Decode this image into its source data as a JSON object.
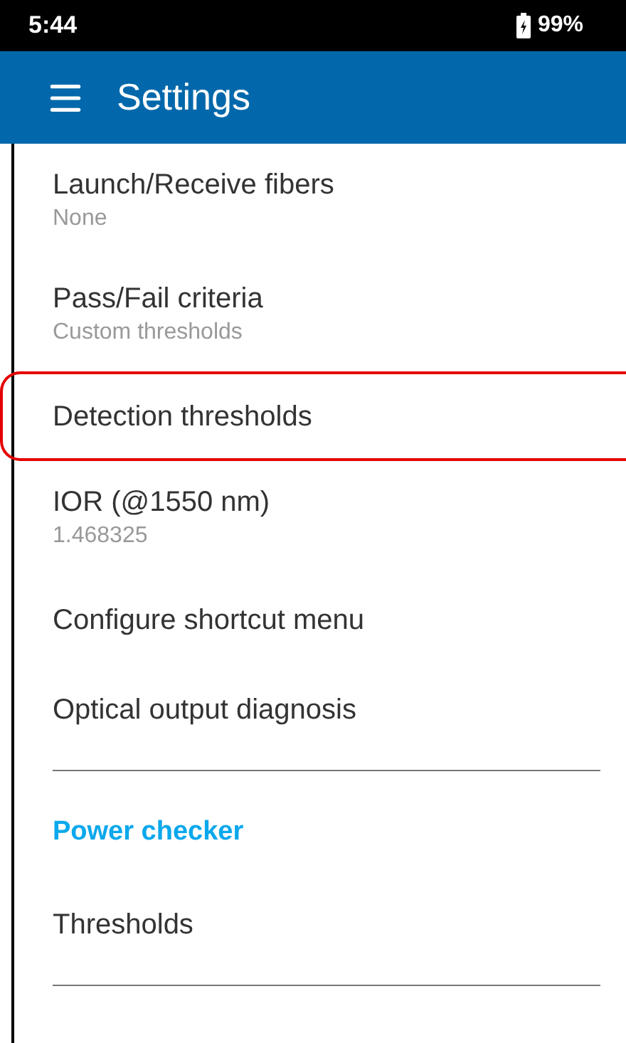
{
  "status_bar": {
    "time": "5:44",
    "battery": "99%"
  },
  "app_bar": {
    "title": "Settings"
  },
  "items": [
    {
      "kind": "item",
      "title": "Launch/Receive fibers",
      "subtitle": "None",
      "selected": false
    },
    {
      "kind": "item",
      "title": "Pass/Fail criteria",
      "subtitle": "Custom thresholds",
      "selected": false
    },
    {
      "kind": "item",
      "title": "Detection thresholds",
      "selected": true
    },
    {
      "kind": "item",
      "title": "IOR (@1550 nm)",
      "subtitle": "1.468325",
      "selected": false
    },
    {
      "kind": "item",
      "title": "Configure shortcut menu",
      "selected": false
    },
    {
      "kind": "item",
      "title": "Optical output diagnosis",
      "selected": false
    },
    {
      "kind": "divider"
    },
    {
      "kind": "header",
      "title": "Power checker"
    },
    {
      "kind": "item",
      "title": "Thresholds",
      "selected": false
    },
    {
      "kind": "divider"
    }
  ]
}
